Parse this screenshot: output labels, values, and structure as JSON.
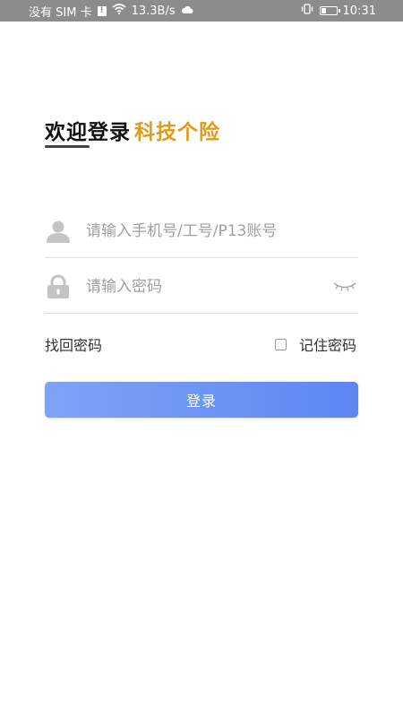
{
  "status_bar": {
    "carrier": "没有 SIM 卡",
    "sim_badge": "!",
    "speed": "13.3B/s",
    "time": "10:31",
    "battery_level": 0.35,
    "icons": [
      "sim-alert-icon",
      "wifi-icon",
      "cloud-icon",
      "vibrate-icon",
      "battery-icon"
    ]
  },
  "header": {
    "welcome": "欢迎登录",
    "brand": "科技个险",
    "brand_color": "#e19b1a"
  },
  "form": {
    "username_placeholder": "请输入手机号/工号/P13账号",
    "username_value": "",
    "password_placeholder": "请输入密码",
    "password_value": "",
    "username_icon": "user-icon",
    "password_icon": "lock-icon",
    "visibility_icon": "eye-closed-icon"
  },
  "options": {
    "forgot_password": "找回密码",
    "remember_password": "记住密码",
    "remember_checked": false
  },
  "login_button": {
    "label": "登录",
    "color_start": "#7fa3f5",
    "color_end": "#5d86f3"
  }
}
